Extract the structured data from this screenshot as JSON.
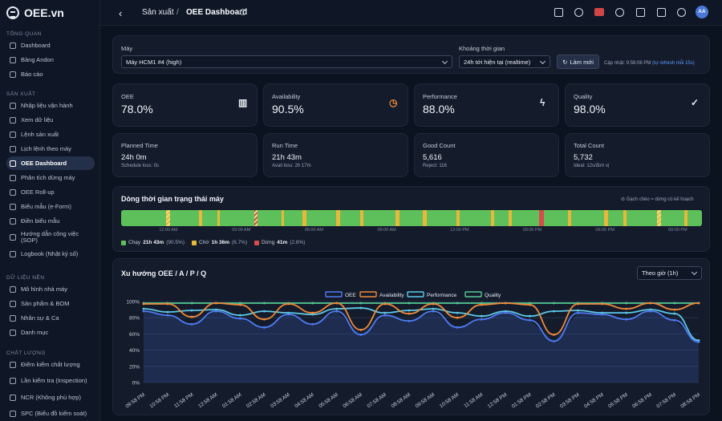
{
  "app": {
    "logo": "OEE.vn"
  },
  "sidebar": {
    "sections": [
      {
        "title": "TỔNG QUAN",
        "items": [
          "Dashboard",
          "Bảng Andon",
          "Báo cáo"
        ]
      },
      {
        "title": "SẢN XUẤT",
        "items": [
          "Nhập liệu vận hành",
          "Xem dữ liệu",
          "Lệnh sản xuất",
          "Lịch lệnh theo máy",
          "OEE Dashboard",
          "Phân tích dừng máy",
          "OEE Roll-up",
          "Biểu mẫu (e-Form)",
          "Điền biểu mẫu",
          "Hướng dẫn công việc (SOP)",
          "Logbook (Nhật ký số)"
        ]
      },
      {
        "title": "DỮ LIỆU NỀN",
        "items": [
          "Mô hình nhà máy",
          "Sản phẩm & BOM",
          "Nhân sự & Ca",
          "Danh mục"
        ]
      },
      {
        "title": "CHẤT LƯỢNG",
        "items": [
          "Điểm kiểm chất lượng",
          "Lần kiểm tra (Inspection)",
          "NCR (Không phù hợp)",
          "SPC (Biểu đồ kiểm soát)"
        ]
      }
    ],
    "active": "OEE Dashboard"
  },
  "topbar": {
    "breadcrumb_parent": "Sản xuất",
    "breadcrumb_sep": "/",
    "breadcrumb_current": "OEE Dashboard",
    "avatar": "AA"
  },
  "filters": {
    "machine_label": "Máy",
    "machine_value": "Máy HCM1 #4 (high)",
    "range_label": "Khoảng thời gian",
    "range_value": "24h tới hiện tại (realtime)",
    "refresh_button": "Làm mới",
    "updated_prefix": "Cập nhật: 9:58:08 PM",
    "updated_link": "(tự refresh mỗi 15s)"
  },
  "kpis": [
    {
      "title": "OEE",
      "value": "78.0%",
      "icon": "bar-chart-icon",
      "color": "#e6ebf3"
    },
    {
      "title": "Availability",
      "value": "90.5%",
      "icon": "clock-icon",
      "color": "#f08a3a"
    },
    {
      "title": "Performance",
      "value": "88.0%",
      "icon": "bolt-icon",
      "color": "#e6ebf3"
    },
    {
      "title": "Quality",
      "value": "98.0%",
      "icon": "check-circle-icon",
      "color": "#e6ebf3"
    }
  ],
  "stats": [
    {
      "title": "Planned Time",
      "value": "24h 0m",
      "sub": "Schedule loss: 0s"
    },
    {
      "title": "Run Time",
      "value": "21h 43m",
      "sub": "Avail loss: 2h 17m"
    },
    {
      "title": "Good Count",
      "value": "5,616",
      "sub": "Reject: 116"
    },
    {
      "title": "Total Count",
      "value": "5,732",
      "sub": "Ideal: 12s/đơn vị"
    }
  ],
  "timeline": {
    "title": "Dòng thời gian trạng thái máy",
    "note": "Gạch chéo = dừng có kế hoạch",
    "ticks": [
      "12:00 AM",
      "03:00 AM",
      "06:00 AM",
      "09:00 AM",
      "12:00 PM",
      "03:00 PM",
      "06:00 PM",
      "09:00 PM"
    ],
    "legend": [
      {
        "label": "Chạy",
        "duration": "21h 43m",
        "pct": "(90.5%)",
        "color": "#5ec05a"
      },
      {
        "label": "Chờ",
        "duration": "1h 36m",
        "pct": "(6.7%)",
        "color": "#e8b83a"
      },
      {
        "label": "Dừng",
        "duration": "41m",
        "pct": "(2.8%)",
        "color": "#d94a4a"
      }
    ]
  },
  "trend": {
    "title": "Xu hướng OEE / A / P / Q",
    "granularity": "Theo giờ (1h)"
  },
  "chart_data": {
    "type": "line",
    "x": [
      "09:58 PM",
      "10:58 PM",
      "11:58 PM",
      "12:58 AM",
      "01:58 AM",
      "02:58 AM",
      "03:58 AM",
      "04:58 AM",
      "05:58 AM",
      "06:58 AM",
      "07:58 AM",
      "08:58 AM",
      "09:58 AM",
      "10:58 AM",
      "11:58 AM",
      "12:58 PM",
      "01:58 PM",
      "02:58 PM",
      "03:58 PM",
      "04:58 PM",
      "05:58 PM",
      "06:58 PM",
      "07:58 PM",
      "08:58 PM"
    ],
    "series": [
      {
        "name": "OEE",
        "color": "#4f7cf2",
        "values": [
          88,
          83,
          72,
          88,
          79,
          68,
          84,
          72,
          88,
          59,
          83,
          76,
          88,
          68,
          78,
          86,
          77,
          51,
          86,
          84,
          78,
          88,
          77,
          50
        ]
      },
      {
        "name": "Availability",
        "color": "#f08a3a",
        "values": [
          97,
          97,
          81,
          98,
          96,
          78,
          97,
          86,
          98,
          65,
          97,
          85,
          97,
          80,
          96,
          98,
          96,
          59,
          97,
          97,
          91,
          98,
          90,
          98
        ]
      },
      {
        "name": "Performance",
        "color": "#5ec8e8",
        "values": [
          91,
          87,
          89,
          90,
          83,
          88,
          86,
          84,
          91,
          92,
          86,
          89,
          91,
          86,
          82,
          88,
          82,
          88,
          89,
          86,
          86,
          90,
          85,
          52
        ]
      },
      {
        "name": "Quality",
        "color": "#56c996",
        "values": [
          98,
          98,
          98,
          98,
          98,
          98,
          98,
          98,
          98,
          98,
          98,
          98,
          98,
          98,
          98,
          98,
          98,
          98,
          98,
          98,
          98,
          98,
          98,
          98
        ]
      }
    ],
    "yticks": [
      "100%",
      "80%",
      "60%",
      "40%",
      "20%",
      "0%"
    ],
    "ylim": [
      0,
      100
    ],
    "legend_position": "top"
  }
}
